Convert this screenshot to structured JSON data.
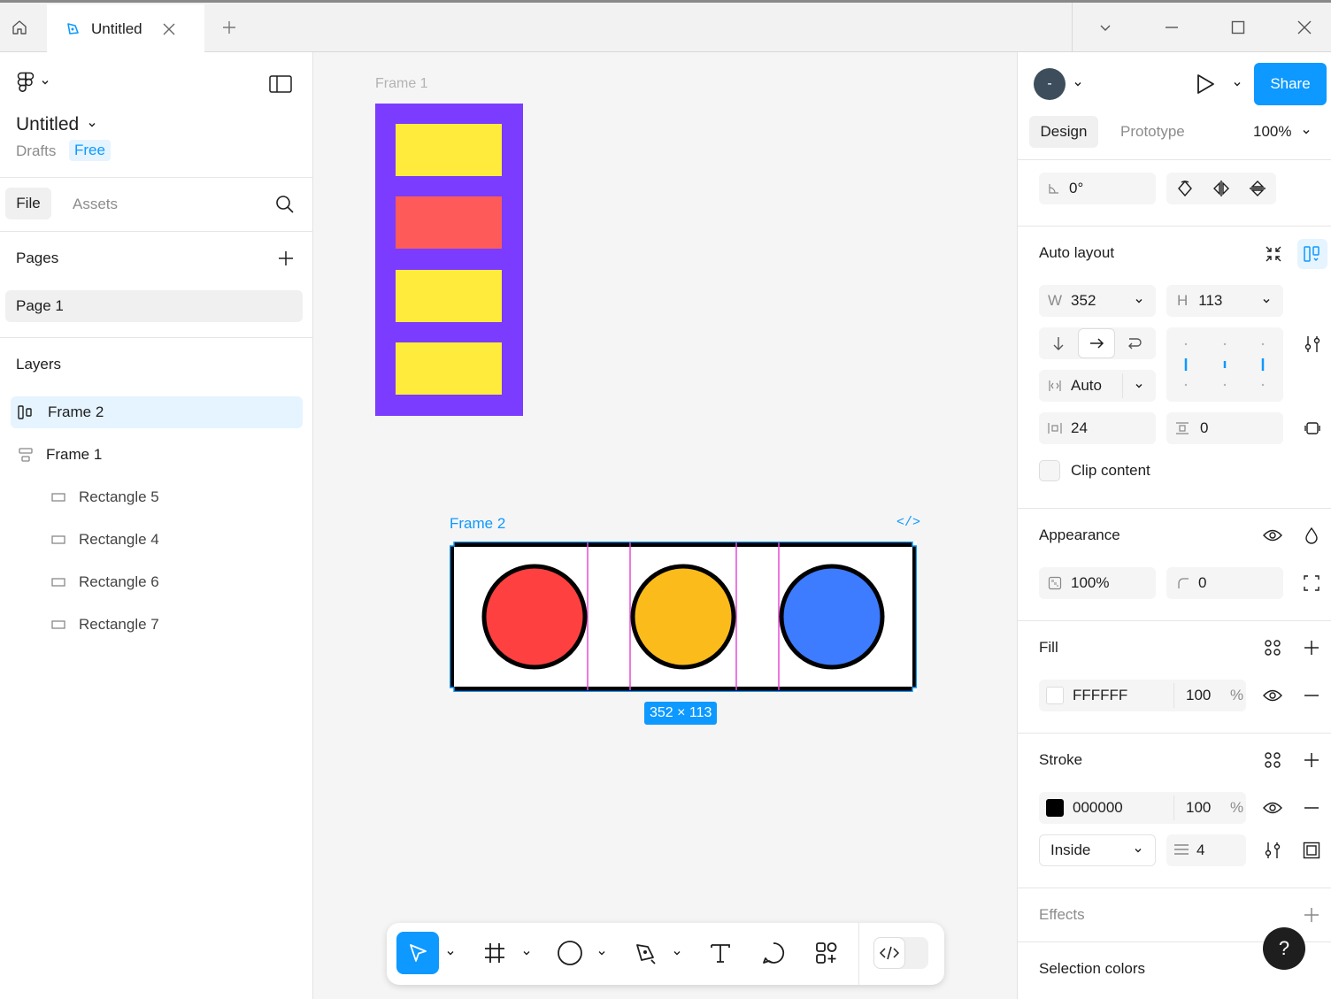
{
  "tabs": {
    "document_title": "Untitled"
  },
  "file": {
    "name": "Untitled",
    "location": "Drafts",
    "plan": "Free"
  },
  "left_tabs": {
    "file": "File",
    "assets": "Assets"
  },
  "pages": {
    "title": "Pages",
    "items": [
      "Page 1"
    ]
  },
  "layers": {
    "title": "Layers",
    "items": [
      {
        "label": "Frame 2",
        "selected": true,
        "icon": "auto-layout-horizontal-icon"
      },
      {
        "label": "Frame 1",
        "selected": false,
        "icon": "auto-layout-vertical-icon"
      },
      {
        "label": "Rectangle 5",
        "selected": false,
        "icon": "rectangle-icon"
      },
      {
        "label": "Rectangle 4",
        "selected": false,
        "icon": "rectangle-icon"
      },
      {
        "label": "Rectangle 6",
        "selected": false,
        "icon": "rectangle-icon"
      },
      {
        "label": "Rectangle 7",
        "selected": false,
        "icon": "rectangle-icon"
      }
    ]
  },
  "canvas": {
    "frame1_label": "Frame 1",
    "frame2_label": "Frame 2",
    "code_icon_label": "</>",
    "size_badge": "352 × 113",
    "frame1_colors": {
      "background": "#7b3cff",
      "yellow": "#ffeb3b",
      "red": "#ff5a5a"
    },
    "circle_colors": [
      "#ff4040",
      "#fbbb1b",
      "#3d7bff"
    ]
  },
  "header": {
    "avatar_initial": "-",
    "share_label": "Share",
    "tabs": {
      "design": "Design",
      "prototype": "Prototype"
    },
    "zoom": "100%"
  },
  "rotation": {
    "value": "0°"
  },
  "auto_layout": {
    "title": "Auto layout",
    "width_label": "W",
    "width": "352",
    "height_label": "H",
    "height": "113",
    "spacing_mode": "Auto",
    "gap": "24",
    "padding": "0",
    "clip_content": "Clip content"
  },
  "appearance": {
    "title": "Appearance",
    "opacity": "100%",
    "radius": "0"
  },
  "fill": {
    "title": "Fill",
    "hex": "FFFFFF",
    "opacity": "100",
    "unit": "%",
    "swatch": "#ffffff"
  },
  "stroke": {
    "title": "Stroke",
    "hex": "000000",
    "opacity": "100",
    "unit": "%",
    "swatch": "#000000",
    "position": "Inside",
    "weight": "4"
  },
  "effects": {
    "title": "Effects"
  },
  "selection_colors": {
    "title": "Selection colors"
  },
  "help": {
    "label": "?"
  },
  "colors": {
    "accent": "#0d99ff",
    "selection_pink": "#e84bd8"
  }
}
